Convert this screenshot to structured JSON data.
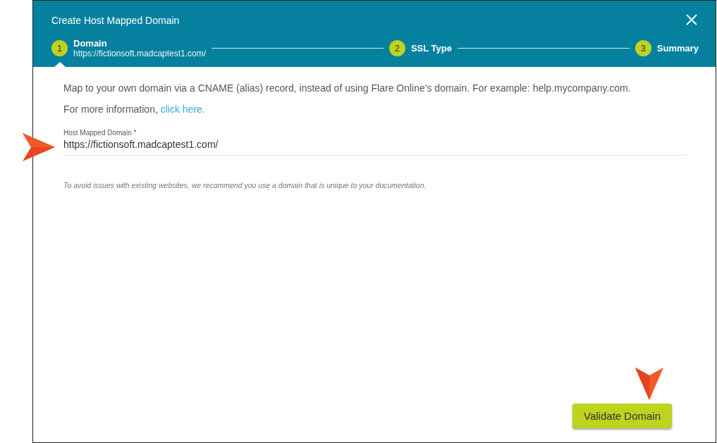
{
  "dialog": {
    "title": "Create Host Mapped Domain"
  },
  "steps": [
    {
      "number": "1",
      "label": "Domain",
      "subtitle": "https://fictionsoft.madcaptest1.com/",
      "selected": true
    },
    {
      "number": "2",
      "label": "SSL Type",
      "selected": false
    },
    {
      "number": "3",
      "label": "Summary",
      "selected": false
    }
  ],
  "intro": "Map to your own domain via a CNAME (alias) record, instead of using Flare Online's domain. For example: help.mycompany.com.",
  "more_info": {
    "text": "For more information,",
    "link": "click here."
  },
  "field": {
    "label": "Host Mapped Domain *",
    "value": "https://fictionsoft.madcaptest1.com/"
  },
  "hint": "To avoid issues with existing websites, we recommend you use a domain that is unique to your documentation.",
  "buttons": [
    {
      "label": "Validate Domain"
    }
  ]
}
